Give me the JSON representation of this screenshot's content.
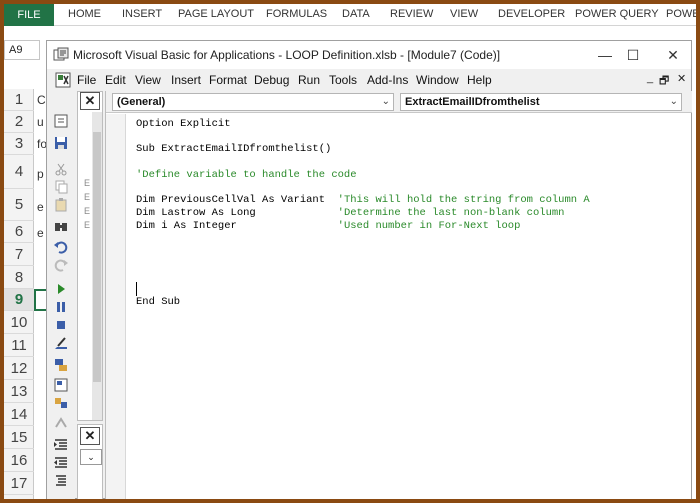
{
  "ribbon": {
    "file_tab": "FILE",
    "tabs": [
      "HOME",
      "INSERT",
      "PAGE LAYOUT",
      "FORMULAS",
      "DATA",
      "REVIEW",
      "VIEW",
      "DEVELOPER",
      "POWER QUERY",
      "POWE"
    ]
  },
  "name_box": "A9",
  "row_headers": [
    "1",
    "2",
    "3",
    "4",
    "5",
    "6",
    "7",
    "8",
    "9",
    "10",
    "11",
    "12",
    "13",
    "14",
    "15",
    "16",
    "17"
  ],
  "cell_chars": [
    "C",
    "u",
    "fo",
    "p",
    "e",
    "e"
  ],
  "vba_window": {
    "title": "Microsoft Visual Basic for Applications - LOOP Definition.xlsb - [Module7 (Code)]",
    "minimize": "—",
    "maximize": "☐",
    "close": "✕"
  },
  "menu": {
    "items": [
      "File",
      "Edit",
      "View",
      "Insert",
      "Format",
      "Debug",
      "Run",
      "Tools",
      "Add-Ins",
      "Window",
      "Help"
    ],
    "mdi_min": "_",
    "mdi_restore": "🗗",
    "mdi_close": "✕"
  },
  "project_pane": {
    "close_label": "✕",
    "lines": [
      "E",
      "E",
      "E",
      "E"
    ]
  },
  "properties_pane": {
    "close_label": "✕",
    "dropdown": "⌄"
  },
  "code_window": {
    "object_combo": "(General)",
    "procedure_combo": "ExtractEmailIDfromthelist",
    "lines": [
      {
        "code": "Option Explicit",
        "comment": ""
      },
      {
        "code": "",
        "comment": ""
      },
      {
        "code": "Sub ExtractEmailIDfromthelist()",
        "comment": ""
      },
      {
        "code": "",
        "comment": ""
      },
      {
        "code": "",
        "comment": "'Define variable to handle the code"
      },
      {
        "code": "",
        "comment": ""
      },
      {
        "code": "Dim PreviousCellVal As Variant  ",
        "comment": "'This will hold the string from column A"
      },
      {
        "code": "Dim Lastrow As Long             ",
        "comment": "'Determine the last non-blank column"
      },
      {
        "code": "Dim i As Integer                ",
        "comment": "'Used number in For-Next loop"
      },
      {
        "code": "",
        "comment": ""
      },
      {
        "code": "",
        "comment": ""
      },
      {
        "code": "",
        "comment": ""
      },
      {
        "code": "",
        "comment": ""
      },
      {
        "code": "",
        "comment": ""
      },
      {
        "code": "End Sub",
        "comment": ""
      }
    ]
  },
  "colors": {
    "excel_green": "#217346",
    "frame": "#8a4a12",
    "comment_green": "#2a8a2a"
  }
}
